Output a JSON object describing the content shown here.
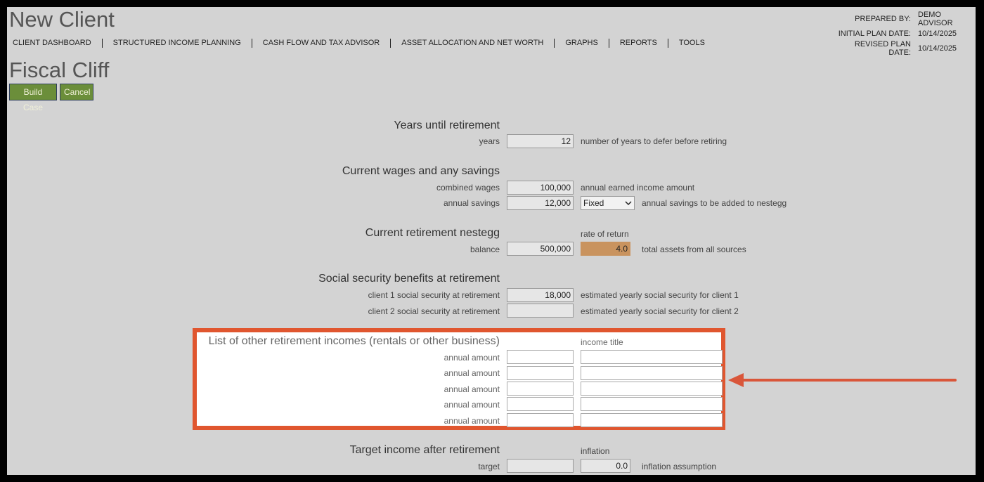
{
  "app": {
    "title": "New Client"
  },
  "meta": {
    "prepared_by_label": "PREPARED BY:",
    "prepared_by_value": "DEMO ADVISOR",
    "initial_label": "INITIAL PLAN DATE:",
    "initial_value": "10/14/2025",
    "revised_label": "REVISED PLAN DATE:",
    "revised_value": "10/14/2025"
  },
  "nav": {
    "items": [
      "CLIENT DASHBOARD",
      "STRUCTURED INCOME PLANNING",
      "CASH FLOW AND TAX ADVISOR",
      "ASSET ALLOCATION AND NET WORTH",
      "GRAPHS",
      "REPORTS",
      "TOOLS"
    ]
  },
  "page": {
    "title": "Fiscal Cliff"
  },
  "buttons": {
    "build": "Build Case",
    "cancel": "Cancel"
  },
  "years": {
    "title": "Years until retirement",
    "label": "years",
    "value": "12",
    "desc": "number of years to defer before retiring"
  },
  "wages": {
    "title": "Current wages and any savings",
    "combined_label": "combined wages",
    "combined_value": "100,000",
    "combined_desc": "annual earned income amount",
    "savings_label": "annual savings",
    "savings_value": "12,000",
    "savings_type": "Fixed",
    "savings_desc": "annual savings to be added to nestegg"
  },
  "nestegg": {
    "title": "Current retirement nestegg",
    "rate_label": "rate of return",
    "balance_label": "balance",
    "balance_value": "500,000",
    "rate_value": "4.0",
    "desc": "total assets from all sources"
  },
  "social": {
    "title": "Social security benefits at retirement",
    "client1_label": "client 1 social security at retirement",
    "client1_value": "18,000",
    "client1_desc": "estimated yearly social security for client 1",
    "client2_label": "client 2 social security at retirement",
    "client2_value": "",
    "client2_desc": "estimated yearly social security for client 2"
  },
  "other_incomes": {
    "title": "List of other retirement incomes (rentals or other business)",
    "income_title_label": "income title",
    "row_label": "annual amount",
    "rows": [
      {
        "amount": "",
        "title": ""
      },
      {
        "amount": "",
        "title": ""
      },
      {
        "amount": "",
        "title": ""
      },
      {
        "amount": "",
        "title": ""
      },
      {
        "amount": "",
        "title": ""
      }
    ]
  },
  "target": {
    "title": "Target income after retirement",
    "inflation_label": "inflation",
    "target_label": "target",
    "target_value": "",
    "inflation_value": "0.0",
    "desc": "inflation assumption"
  },
  "colors": {
    "highlight": "#e0562f",
    "button": "#6b8e3a",
    "rate_field": "#c9935e"
  }
}
